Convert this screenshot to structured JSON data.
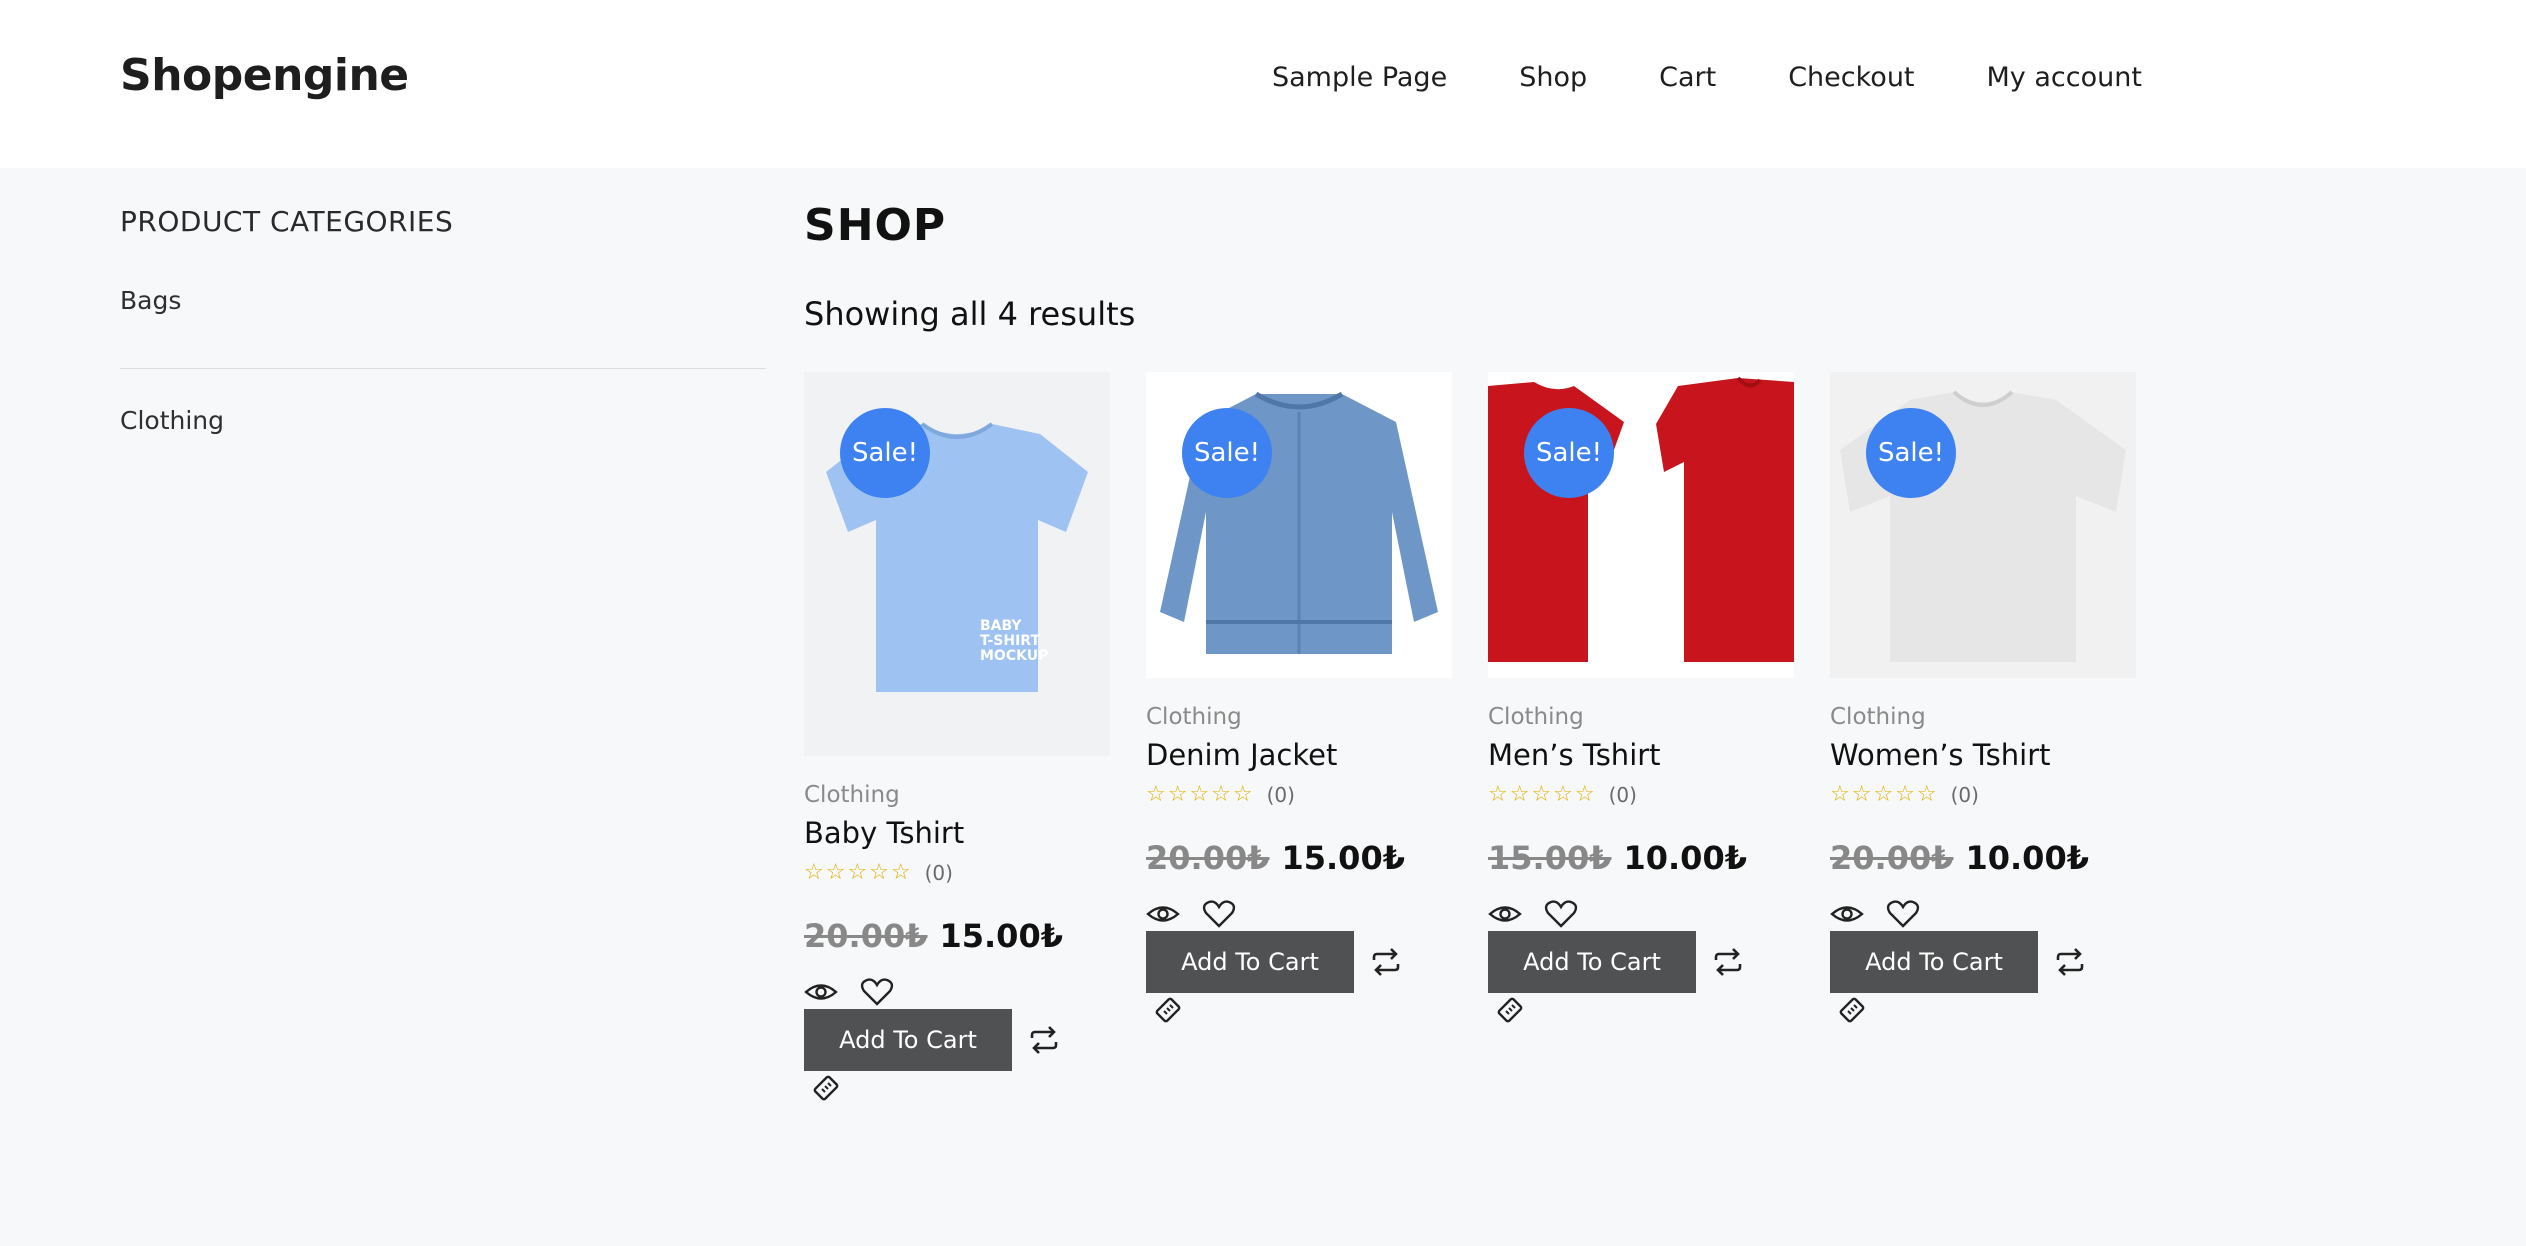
{
  "site": {
    "logo": "Shopengine"
  },
  "nav": [
    "Sample Page",
    "Shop",
    "Cart",
    "Checkout",
    "My account"
  ],
  "sidebar": {
    "title": "PRODUCT CATEGORIES",
    "items": [
      "Bags",
      "Clothing"
    ]
  },
  "main": {
    "title": "SHOP",
    "result_count": "Showing all 4 results"
  },
  "products": [
    {
      "badge": "Sale!",
      "category": "Clothing",
      "name": "Baby Tshirt",
      "stars": "☆☆☆☆☆",
      "rating_count": "(0)",
      "old_price": "20.00₺",
      "price": "15.00₺",
      "add_to_cart": "Add To Cart",
      "image_text": "BABY T-SHIRT MOCKUP"
    },
    {
      "badge": "Sale!",
      "category": "Clothing",
      "name": "Denim Jacket",
      "stars": "☆☆☆☆☆",
      "rating_count": "(0)",
      "old_price": "20.00₺",
      "price": "15.00₺",
      "add_to_cart": "Add To Cart"
    },
    {
      "badge": "Sale!",
      "category": "Clothing",
      "name": "Men’s Tshirt",
      "stars": "☆☆☆☆☆",
      "rating_count": "(0)",
      "old_price": "15.00₺",
      "price": "10.00₺",
      "add_to_cart": "Add To Cart"
    },
    {
      "badge": "Sale!",
      "category": "Clothing",
      "name": "Women’s Tshirt",
      "stars": "☆☆☆☆☆",
      "rating_count": "(0)",
      "old_price": "20.00₺",
      "price": "10.00₺",
      "add_to_cart": "Add To Cart"
    }
  ],
  "colors": {
    "sale_badge": "#3d82f0",
    "button": "#505153",
    "stars": "#e2b100"
  }
}
